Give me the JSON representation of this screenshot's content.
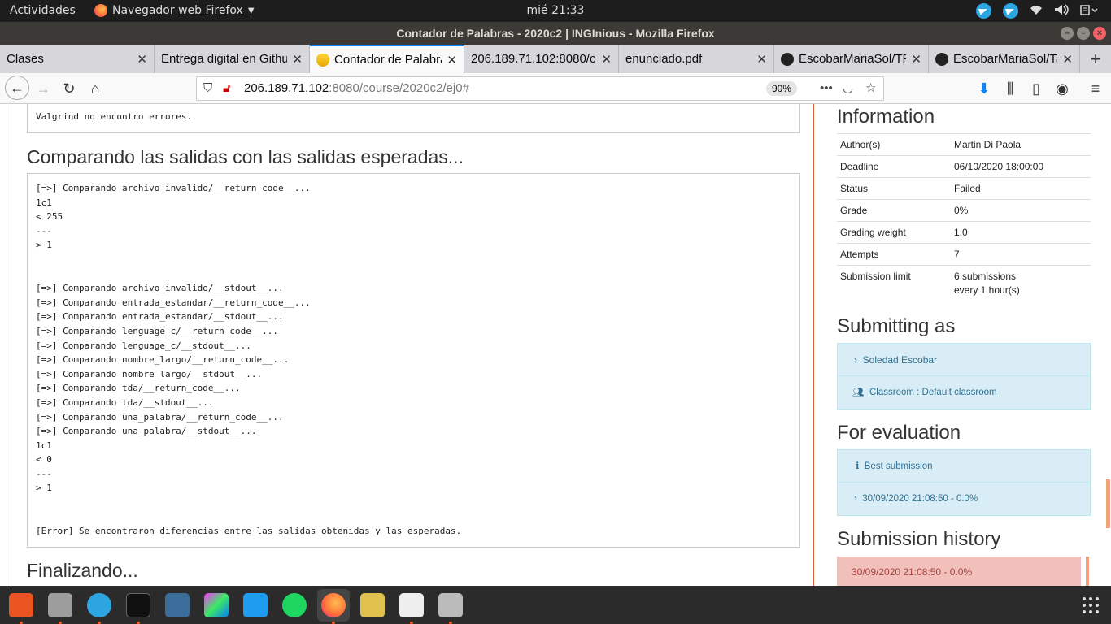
{
  "topbar": {
    "activities": "Actividades",
    "app_name": "Navegador web Firefox",
    "clock": "mié 21:33"
  },
  "window": {
    "title": "Contador de Palabras - 2020c2 | INGInious - Mozilla Firefox"
  },
  "tabs": [
    {
      "label": "Clases"
    },
    {
      "label": "Entrega digital en Github"
    },
    {
      "label": "Contador de Palabras"
    },
    {
      "label": "206.189.71.102:8080/c"
    },
    {
      "label": "enunciado.pdf"
    },
    {
      "label": "EscobarMariaSol/TP"
    },
    {
      "label": "EscobarMariaSol/Ta"
    }
  ],
  "navbar": {
    "url_host": "206.189.71.102",
    "url_rest": ":8080/course/2020c2/ej0#",
    "zoom": "90%"
  },
  "main": {
    "valgrind_line": "Valgrind no encontro errores.",
    "compare_heading": "Comparando las salidas con las salidas esperadas...",
    "compare_lines": [
      "[=>] Comparando archivo_invalido/__return_code__...",
      "1c1",
      "< 255",
      "---",
      "> 1",
      "",
      "",
      "[=>] Comparando archivo_invalido/__stdout__...",
      "[=>] Comparando entrada_estandar/__return_code__...",
      "[=>] Comparando entrada_estandar/__stdout__...",
      "[=>] Comparando lenguage_c/__return_code__...",
      "[=>] Comparando lenguage_c/__stdout__...",
      "[=>] Comparando nombre_largo/__return_code__...",
      "[=>] Comparando nombre_largo/__stdout__...",
      "[=>] Comparando tda/__return_code__...",
      "[=>] Comparando tda/__stdout__...",
      "[=>] Comparando una_palabra/__return_code__...",
      "[=>] Comparando una_palabra/__stdout__...",
      "1c1",
      "< 0",
      "---",
      "> 1",
      "",
      "",
      "[Error] Se encontraron diferencias entre las salidas obtenidas y las esperadas."
    ],
    "final_heading": "Finalizando..."
  },
  "sidebar": {
    "info_heading": "Information",
    "info_rows": [
      {
        "k": "Author(s)",
        "v": "Martin Di Paola"
      },
      {
        "k": "Deadline",
        "v": "06/10/2020 18:00:00"
      },
      {
        "k": "Status",
        "v": "Failed"
      },
      {
        "k": "Grade",
        "v": "0%"
      },
      {
        "k": "Grading weight",
        "v": "1.0"
      },
      {
        "k": "Attempts",
        "v": "7"
      },
      {
        "k": "Submission limit",
        "v": "6 submissions",
        "v2": "every 1 hour(s)"
      }
    ],
    "submitting_heading": "Submitting as",
    "submitter": "Soledad Escobar",
    "classroom": "Classroom : Default classroom",
    "evaluation_heading": "For evaluation",
    "best_submission": "Best submission",
    "eval_submission": "30/09/2020 21:08:50 - 0.0%",
    "history_heading": "Submission history",
    "history_item": "30/09/2020 21:08:50 - 0.0%"
  },
  "colors": {
    "accent_tab": "#0a84ff",
    "panel_bg": "#d9edf7",
    "panel_text": "#31708f",
    "history_bg": "#f2c0bb",
    "column_border": "#e05a42"
  }
}
